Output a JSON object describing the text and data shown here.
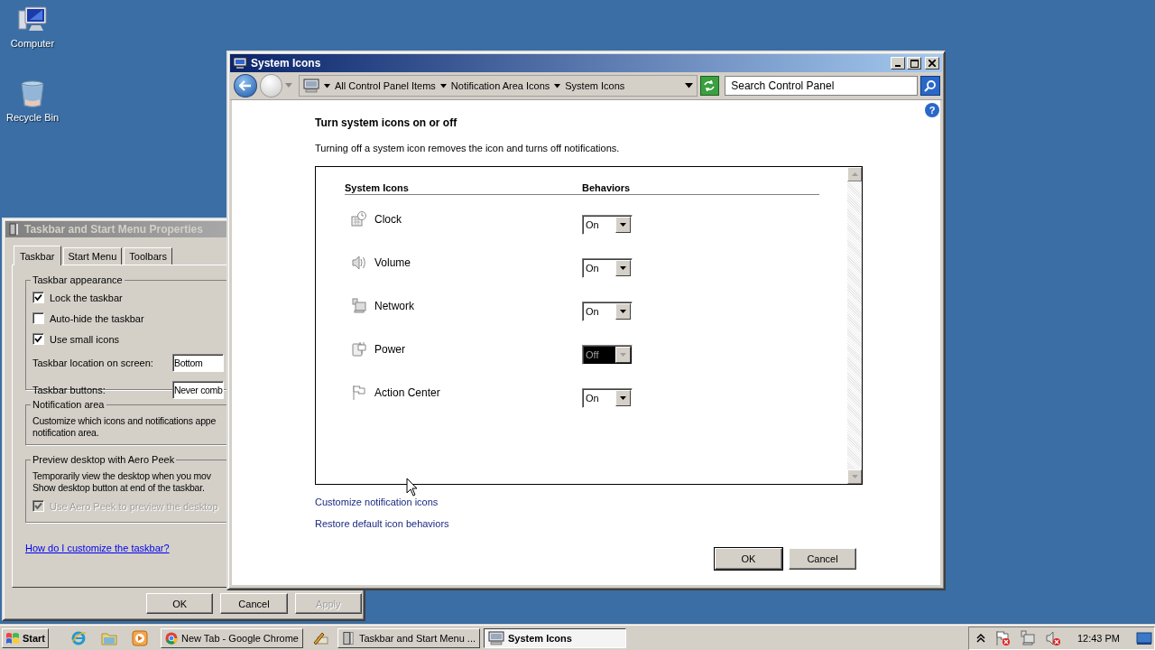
{
  "desktop_icons": [
    {
      "label": "Computer",
      "kind": "computer"
    },
    {
      "label": "Recycle Bin",
      "kind": "recycle"
    }
  ],
  "back_window": {
    "title": "Taskbar and Start Menu Properties",
    "active": false,
    "tabs": [
      {
        "label": "Taskbar",
        "selected": true
      },
      {
        "label": "Start Menu",
        "selected": false
      },
      {
        "label": "Toolbars",
        "selected": false
      }
    ],
    "appearance": {
      "legend": "Taskbar appearance",
      "checkboxes": [
        {
          "label": "Lock the taskbar",
          "checked": true
        },
        {
          "label": "Auto-hide the taskbar",
          "checked": false
        },
        {
          "label": "Use small icons",
          "checked": true
        }
      ],
      "fields": [
        {
          "label": "Taskbar location on screen:",
          "value": "Bottom"
        },
        {
          "label": "Taskbar buttons:",
          "value": "Never comb"
        }
      ]
    },
    "notification": {
      "legend": "Notification area",
      "lines": [
        "Customize which icons and notifications appe",
        "notification area."
      ]
    },
    "peek": {
      "legend": "Preview desktop with Aero Peek",
      "lines": [
        "Temporarily view the desktop when you mov",
        "Show desktop button at end of the taskbar."
      ],
      "checkbox": {
        "label": "Use Aero Peek to preview the desktop",
        "checked": true,
        "disabled": true
      }
    },
    "help_link": "How do I customize the taskbar?",
    "buttons": [
      {
        "label": "OK",
        "disabled": false
      },
      {
        "label": "Cancel",
        "disabled": false
      },
      {
        "label": "Apply",
        "disabled": true
      }
    ]
  },
  "window": {
    "title": "System Icons",
    "active": true,
    "address": {
      "crumbs": [
        "All Control Panel Items",
        "Notification Area Icons",
        "System Icons"
      ]
    },
    "search": {
      "placeholder": "Search Control Panel"
    },
    "help": "?",
    "heading": "Turn system icons on or off",
    "description": "Turning off a system icon removes the icon and turns off notifications.",
    "table": {
      "columns": [
        "System Icons",
        "Behaviors"
      ],
      "rows": [
        {
          "name": "Clock",
          "kind": "clock",
          "value": "On",
          "focused": false
        },
        {
          "name": "Volume",
          "kind": "volume",
          "value": "On",
          "focused": false
        },
        {
          "name": "Network",
          "kind": "network",
          "value": "On",
          "focused": false
        },
        {
          "name": "Power",
          "kind": "power",
          "value": "Off",
          "focused": true
        },
        {
          "name": "Action Center",
          "kind": "flag",
          "value": "On",
          "focused": false
        }
      ]
    },
    "links": [
      "Customize notification icons",
      "Restore default icon behaviors"
    ],
    "buttons": [
      {
        "label": "OK",
        "default": true
      },
      {
        "label": "Cancel",
        "default": false
      }
    ]
  },
  "taskbar": {
    "start": "Start",
    "quick_launch": [
      {
        "kind": "ie"
      },
      {
        "kind": "folder"
      },
      {
        "kind": "media"
      }
    ],
    "tasks": [
      {
        "label": "New Tab - Google Chrome",
        "kind": "chrome",
        "selected": false
      },
      {
        "kind": "pen",
        "selected": false
      },
      {
        "label": "Taskbar and Start Menu ...",
        "kind": "props",
        "selected": false
      },
      {
        "label": "System Icons",
        "kind": "computer",
        "selected": true
      }
    ],
    "tray": {
      "icons": [
        {
          "kind": "flag"
        },
        {
          "kind": "network"
        },
        {
          "kind": "volume"
        }
      ],
      "time": "12:43 PM"
    }
  }
}
